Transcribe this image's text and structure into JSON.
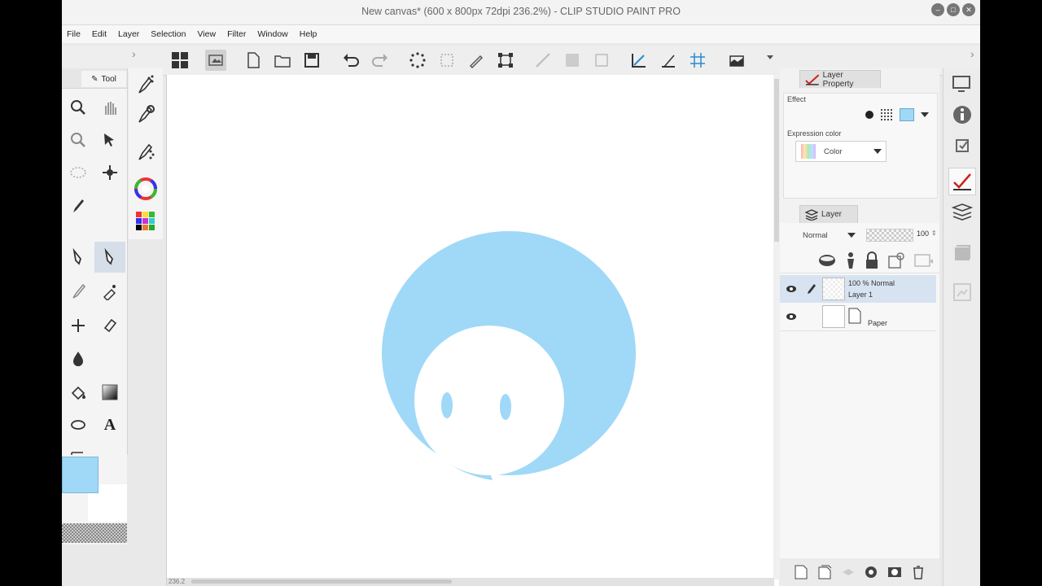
{
  "window": {
    "title": "New canvas* (600 x 800px 72dpi 236.2%)  - CLIP STUDIO PAINT PRO",
    "controls": [
      "minimize-icon",
      "maximize-icon",
      "close-icon"
    ]
  },
  "menu": [
    "File",
    "Edit",
    "Layer",
    "Selection",
    "View",
    "Filter",
    "Window",
    "Help"
  ],
  "tool_panel": {
    "tab_label": "Tool",
    "tools": [
      "zoom-icon",
      "hand-icon",
      "rotate-view-icon",
      "move-layer-icon",
      "ellipse-selection-icon",
      "auto-select-icon",
      "eyedropper-icon",
      "pen-icon",
      "pencil-icon",
      "brush-icon",
      "airbrush-icon",
      "decoration-icon",
      "eraser-icon",
      "blend-icon",
      "fill-icon",
      "gradient-icon",
      "figure-icon",
      "text-icon",
      "operation-icon"
    ]
  },
  "colors": {
    "main": "#a0d8f8",
    "sub": "#ffffff",
    "canvas_shape": "#a0d8f8"
  },
  "layer_property": {
    "tab_label": "Layer Property",
    "effect_label": "Effect",
    "expression_label": "Expression color",
    "expression_value": "Color"
  },
  "layer_panel": {
    "tab_label": "Layer",
    "blend_mode": "Normal",
    "opacity": "100",
    "layers": [
      {
        "opacity_mode": "100 %  Normal",
        "name": "Layer 1",
        "selected": true
      },
      {
        "opacity_mode": "",
        "name": "Paper",
        "selected": false
      }
    ]
  },
  "status": {
    "zoom": "236.2"
  }
}
